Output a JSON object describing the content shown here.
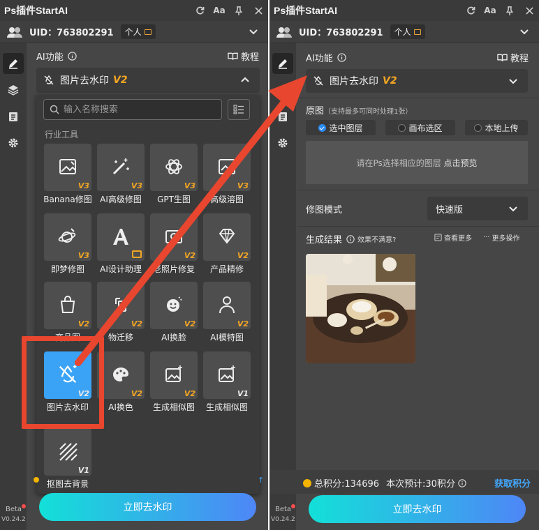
{
  "app": {
    "title": "Ps插件StartAI",
    "font_size_btn": "Aa"
  },
  "user": {
    "uid": "UID：763802291",
    "plan": "个人"
  },
  "sidebar": {
    "beta": "Beta",
    "version": "V0.24.2"
  },
  "ai_section": {
    "label": "AI功能",
    "tutorial": "教程"
  },
  "current_tool": {
    "name": "图片去水印",
    "version": "V2"
  },
  "search": {
    "placeholder": "输入名称搜索"
  },
  "category": "行业工具",
  "tools": [
    {
      "name": "Banana修图",
      "version": "V3",
      "icon": "image-edit-icon"
    },
    {
      "name": "AI高级修图",
      "version": "V3",
      "icon": "magic-wand-icon"
    },
    {
      "name": "GPT生图",
      "version": "V3",
      "icon": "gpt-logo-icon"
    },
    {
      "name": "高级溶图",
      "version": "V3",
      "icon": "image-blend-icon"
    },
    {
      "name": "即梦修图",
      "version": "V3",
      "icon": "planet-edit-icon"
    },
    {
      "name": "AI设计助理",
      "version": "",
      "icon": "ai-design-icon"
    },
    {
      "name": "老照片修复",
      "version": "V2",
      "icon": "photo-repair-icon"
    },
    {
      "name": "产品精修",
      "version": "V2",
      "icon": "diamond-icon"
    },
    {
      "name": "商品图",
      "version": "V2",
      "icon": "shopping-bag-icon"
    },
    {
      "name": "物迁移",
      "version": "V2",
      "icon": "transfer-icon"
    },
    {
      "name": "AI换脸",
      "version": "V2",
      "icon": "face-swap-icon"
    },
    {
      "name": "AI模特图",
      "version": "V2",
      "icon": "model-icon"
    },
    {
      "name": "图片去水印",
      "version": "V2",
      "icon": "no-watermark-icon"
    },
    {
      "name": "AI换色",
      "version": "V2",
      "icon": "palette-icon"
    },
    {
      "name": "生成相似图",
      "version": "V2",
      "icon": "image-sparkle-icon"
    },
    {
      "name": "生成相似图",
      "version": "V1",
      "icon": "image-sparkle-icon"
    },
    {
      "name": "抠图去背景",
      "version": "V1",
      "icon": "cutout-icon"
    }
  ],
  "primary_button": "立即去水印",
  "right": {
    "source_label": "原图",
    "source_note": "（支持最多可同时处理1张）",
    "source_options": [
      "选中图层",
      "画布选区",
      "本地上传"
    ],
    "preview_text": "请在Ps选择相应的图层",
    "preview_link": "点击预览",
    "mode_label": "修图模式",
    "mode_value": "快速版",
    "result_label": "生成结果",
    "result_note": "效果不满意?",
    "view_more": "查看更多",
    "more_ops": "更多操作",
    "total_points": "总积分:134696",
    "estimate": "本次预计:30积分",
    "get_points": "获取积分"
  },
  "colors": {
    "accent": "#3aa3f5",
    "highlight_red": "#e8462f",
    "version_tag": "#f5a623",
    "link": "#42a8ff"
  }
}
